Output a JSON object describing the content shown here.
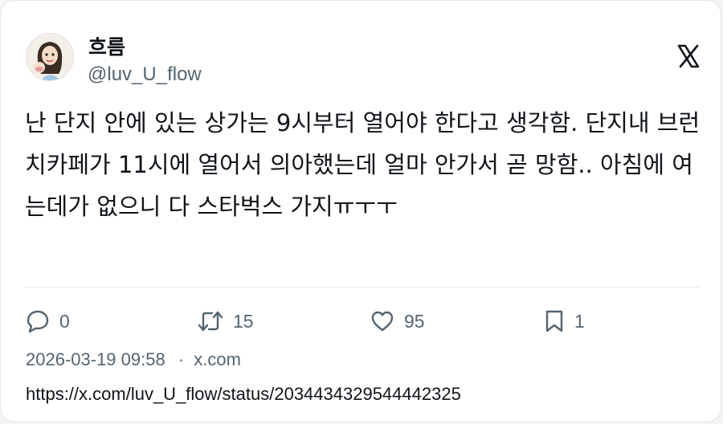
{
  "author": {
    "display_name": "흐름",
    "handle": "@luv_U_flow",
    "avatar_icon": "cartoon-avatar-icon"
  },
  "brand_icon": "x-logo-icon",
  "tweet": {
    "text": "난 단지 안에 있는 상가는 9시부터 열어야 한다고 생각함. 단지내 브런치카페가 11시에 열어서 의아했는데 얼마 안가서 곧 망함.. 아침에 여는데가 없으니 다 스타벅스 가지ㅠㅜㅜ"
  },
  "actions": {
    "reply": {
      "icon": "reply-icon",
      "count": "0"
    },
    "retweet": {
      "icon": "retweet-icon",
      "count": "15"
    },
    "like": {
      "icon": "heart-icon",
      "count": "95"
    },
    "bookmark": {
      "icon": "bookmark-icon",
      "count": "1"
    }
  },
  "meta": {
    "timestamp": "2026-03-19 09:58",
    "separator": "·",
    "source": "x.com"
  },
  "url": "https://x.com/luv_U_flow/status/2034434329544442325",
  "colors": {
    "text": "#0f1419",
    "secondary": "#536471",
    "border": "#e6e6e6"
  }
}
